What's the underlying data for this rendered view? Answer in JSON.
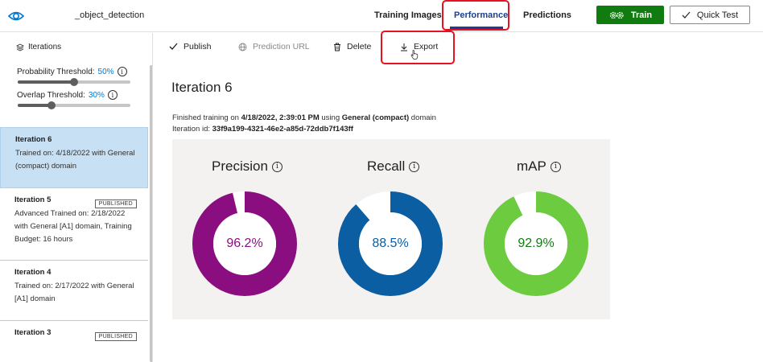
{
  "header": {
    "project_name": "_object_detection",
    "tabs": [
      "Training Images",
      "Performance",
      "Predictions"
    ],
    "active_tab": "Performance",
    "train_label": "Train",
    "quick_test_label": "Quick Test"
  },
  "sidebar": {
    "heading": "Iterations",
    "probability_threshold": {
      "label": "Probability Threshold:",
      "value": "50%",
      "level": 0.5
    },
    "overlap_threshold": {
      "label": "Overlap Threshold:",
      "value": "30%",
      "level": 0.3
    },
    "iterations": [
      {
        "title": "Iteration 6",
        "description": "Trained on: 4/18/2022 with General (compact) domain",
        "badge": "",
        "selected": true
      },
      {
        "title": "Iteration 5",
        "description": "Advanced Trained on: 2/18/2022 with General [A1] domain, Training Budget: 16 hours",
        "badge": "PUBLISHED",
        "selected": false
      },
      {
        "title": "Iteration 4",
        "description": "Trained on: 2/17/2022 with General [A1] domain",
        "badge": "",
        "selected": false
      },
      {
        "title": "Iteration 3",
        "description": "",
        "badge": "PUBLISHED",
        "selected": false
      }
    ]
  },
  "toolbar": {
    "publish": "Publish",
    "prediction_url": "Prediction URL",
    "delete": "Delete",
    "export": "Export"
  },
  "main": {
    "iteration_title": "Iteration 6",
    "finished_prefix": "Finished training on ",
    "finished_date": "4/18/2022, 2:39:01 PM",
    "using_text": " using ",
    "domain": "General (compact)",
    "domain_suffix": " domain",
    "iteration_id_label": "Iteration id: ",
    "iteration_id": "33f9a199-4321-46e2-a85d-72ddb7f143ff"
  },
  "metrics": [
    {
      "name": "Precision",
      "value_text": "96.2%",
      "value": 96.2,
      "color": "#8b0e80"
    },
    {
      "name": "Recall",
      "value_text": "88.5%",
      "value": 88.5,
      "color": "#0c5ea3"
    },
    {
      "name": "mAP",
      "value_text": "92.9%",
      "value": 92.9,
      "color": "#6ccb3e",
      "text_color": "#107c10"
    }
  ],
  "colors": {
    "accent": "#1b3f8f",
    "train_green": "#107c10",
    "selected_bg": "#c7e0f4",
    "highlight_red": "#e81123"
  },
  "icons": {
    "app": "eye-icon",
    "train": "gears-icon",
    "quick_test": "checkmark-icon",
    "publish": "checkmark-icon",
    "prediction_url": "globe-icon",
    "delete": "trash-icon",
    "export": "download-icon",
    "iterations": "stack-icon",
    "info": "info-icon",
    "cursor": "hand-pointer-icon"
  }
}
